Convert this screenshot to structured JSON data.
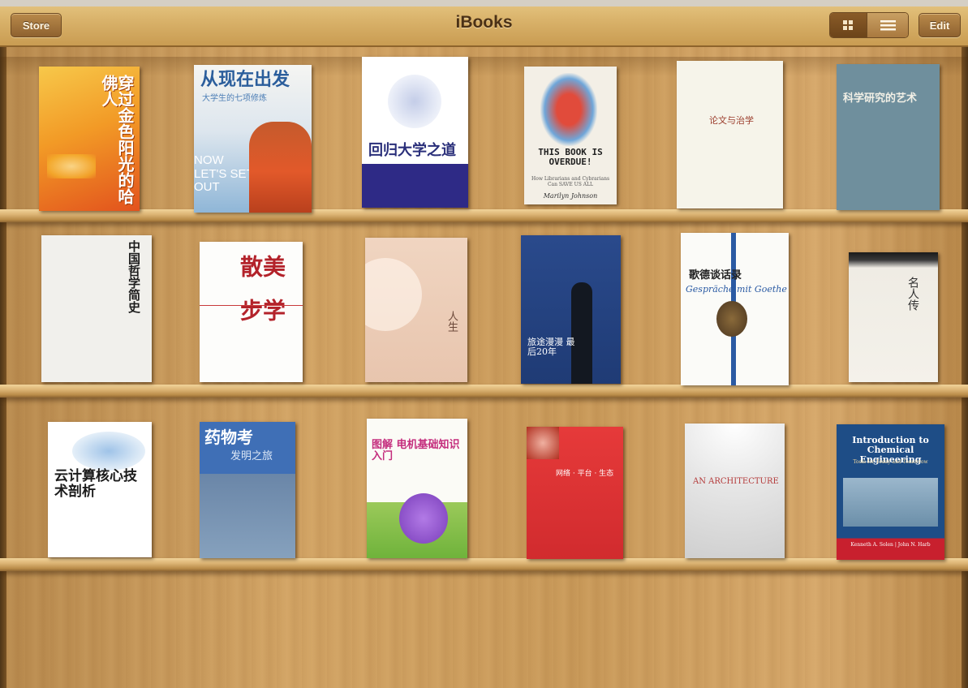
{
  "toolbar": {
    "store_label": "Store",
    "title": "iBooks",
    "edit_label": "Edit",
    "view_modes": [
      "grid",
      "list"
    ],
    "selected_view": "grid"
  },
  "shelves": [
    {
      "books": [
        {
          "title": "穿过金色阳光的哈佛人"
        },
        {
          "title": "从现在出发",
          "subtitle": "大学生的七项修炼",
          "english": "NOW LET'S SET OUT"
        },
        {
          "title": "回归大学之道"
        },
        {
          "title": "THIS BOOK IS OVERDUE!",
          "subtitle": "How Librarians and Cybrarians Can SAVE US ALL",
          "author": "Marilyn Johnson"
        },
        {
          "title": "论文与治学"
        },
        {
          "title": "科学研究的艺术"
        }
      ]
    },
    {
      "books": [
        {
          "title": "中国哲学简史"
        },
        {
          "title": "美学散步"
        },
        {
          "title": "人生"
        },
        {
          "title": "旅途漫漫 最后20年"
        },
        {
          "title": "歌德谈话录",
          "english": "Gespräche mit Goethe"
        },
        {
          "title": "名人传"
        }
      ]
    },
    {
      "books": [
        {
          "title": "云计算核心技术剖析"
        },
        {
          "title": "药物考",
          "subtitle": "发明之旅"
        },
        {
          "title": "图解 电机基础知识入门"
        },
        {
          "title": "网络 · 平台 · 生态"
        },
        {
          "title": "AN ARCHITECTURE"
        },
        {
          "title": "Introduction to Chemical Engineering",
          "subtitle": "Tools for Today and Tomorrow",
          "author": "Kenneth A. Solen | John N. Harb"
        }
      ]
    }
  ],
  "colors": {
    "toolbar": "#d9b26a",
    "shelf_wood": "#c99a5a",
    "button_text": "#fff6e3",
    "title_text": "#4b3116"
  }
}
